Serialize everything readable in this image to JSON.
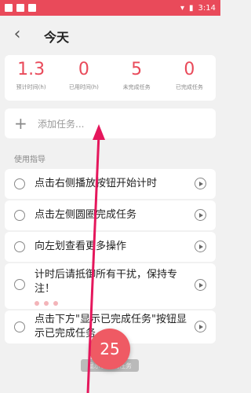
{
  "status_bar": {
    "time": "3:14"
  },
  "header": {
    "title": "今天"
  },
  "stats": [
    {
      "value": "1.3",
      "label": "预计时间(h)"
    },
    {
      "value": "0",
      "label": "已用时间(h)"
    },
    {
      "value": "5",
      "label": "未完成任务"
    },
    {
      "value": "0",
      "label": "已完成任务"
    }
  ],
  "add_task": {
    "placeholder": "添加任务..."
  },
  "guide": {
    "section_label": "使用指导"
  },
  "tasks": [
    {
      "text": "点击右侧播放按钮开始计时"
    },
    {
      "text": "点击左侧圆圈完成任务"
    },
    {
      "text": "向左划查看更多操作"
    },
    {
      "text": "计时后请抵御所有干扰，保持专注！"
    },
    {
      "text": "点击下方\"显示已完成任务\"按钮显示已完成任务"
    }
  ],
  "fab": {
    "value": "25"
  },
  "show_done_button": {
    "label": "显示已完成任务"
  },
  "colors": {
    "accent": "#e94a5a",
    "fab": "#ef5a64"
  }
}
